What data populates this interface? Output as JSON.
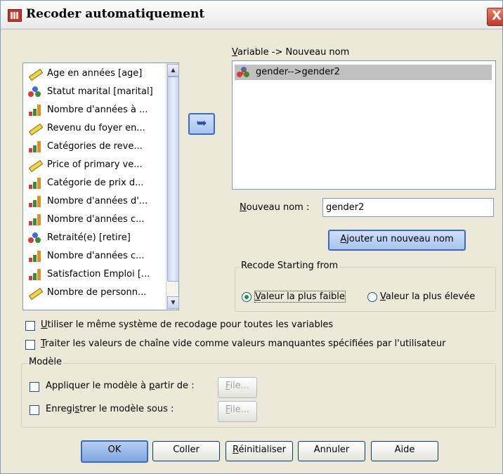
{
  "window": {
    "title": "Recoder automatiquement",
    "close_glyph": "X"
  },
  "variable_list": {
    "items": [
      {
        "label": "Age en années [age]",
        "icon": "scale-icon"
      },
      {
        "label": "Statut marital [marital]",
        "icon": "nominal-icon"
      },
      {
        "label": "Nombre d'années à ...",
        "icon": "ordinal-icon"
      },
      {
        "label": "Revenu du foyer en...",
        "icon": "scale-icon"
      },
      {
        "label": "Catégories de reve...",
        "icon": "ordinal-icon"
      },
      {
        "label": "Price of primary ve...",
        "icon": "scale-icon"
      },
      {
        "label": "Catégorie de prix d...",
        "icon": "ordinal-icon"
      },
      {
        "label": "Nombre d'années d'...",
        "icon": "ordinal-icon"
      },
      {
        "label": "Nombre d'années c...",
        "icon": "ordinal-icon"
      },
      {
        "label": "Retraité(e) [retire]",
        "icon": "nominal-icon"
      },
      {
        "label": "Nombre d'années c...",
        "icon": "ordinal-icon"
      },
      {
        "label": "Satisfaction Emploi [...",
        "icon": "ordinal-icon"
      },
      {
        "label": "Nombre de personn...",
        "icon": "scale-icon"
      }
    ]
  },
  "move_button": {
    "glyph": "➥",
    "icon": "arrow-left-icon"
  },
  "mapping": {
    "label_prefix": "V",
    "label_rest": "ariable -> Nouveau nom",
    "items": [
      {
        "label": "gender-->gender2",
        "icon": "string-nominal-icon"
      }
    ]
  },
  "new_name": {
    "label_prefix": "N",
    "label_rest": "ouveau nom :",
    "value": "gender2"
  },
  "add_name_button": {
    "prefix": "A",
    "rest": "jouter un nouveau nom"
  },
  "recode_group": {
    "title": "Recode Starting from",
    "lowest": {
      "prefix": "V",
      "rest": "aleur la plus faible",
      "selected": true
    },
    "highest": {
      "prefix": "V",
      "rest": "aleur la plus élevée",
      "selected": false
    }
  },
  "options": {
    "same_scheme": {
      "prefix": "U",
      "rest": "tiliser le même système de recodage pour toutes les variables",
      "checked": false
    },
    "blank_strings": {
      "prefix": "T",
      "rest": "raiter les valeurs de chaîne vide comme valeurs manquantes spécifiées par l'utilisateur",
      "checked": false
    }
  },
  "model_group": {
    "title": "Modèle",
    "apply": {
      "before": "Appliquer le modèle à ",
      "u": "p",
      "after": "artir de :",
      "checked": false
    },
    "save": {
      "before": "Enregi",
      "u": "s",
      "after": "trer le modèle sous :",
      "checked": false
    },
    "file_button": {
      "u": "F",
      "rest": "ile..."
    },
    "file_button2": {
      "u": "F",
      "rest": "ile..."
    }
  },
  "footer": {
    "ok": "OK",
    "paste": "Coller",
    "reset_u": "R",
    "reset_rest": "éinitialiser",
    "cancel": "Annuler",
    "help": "Aide"
  }
}
